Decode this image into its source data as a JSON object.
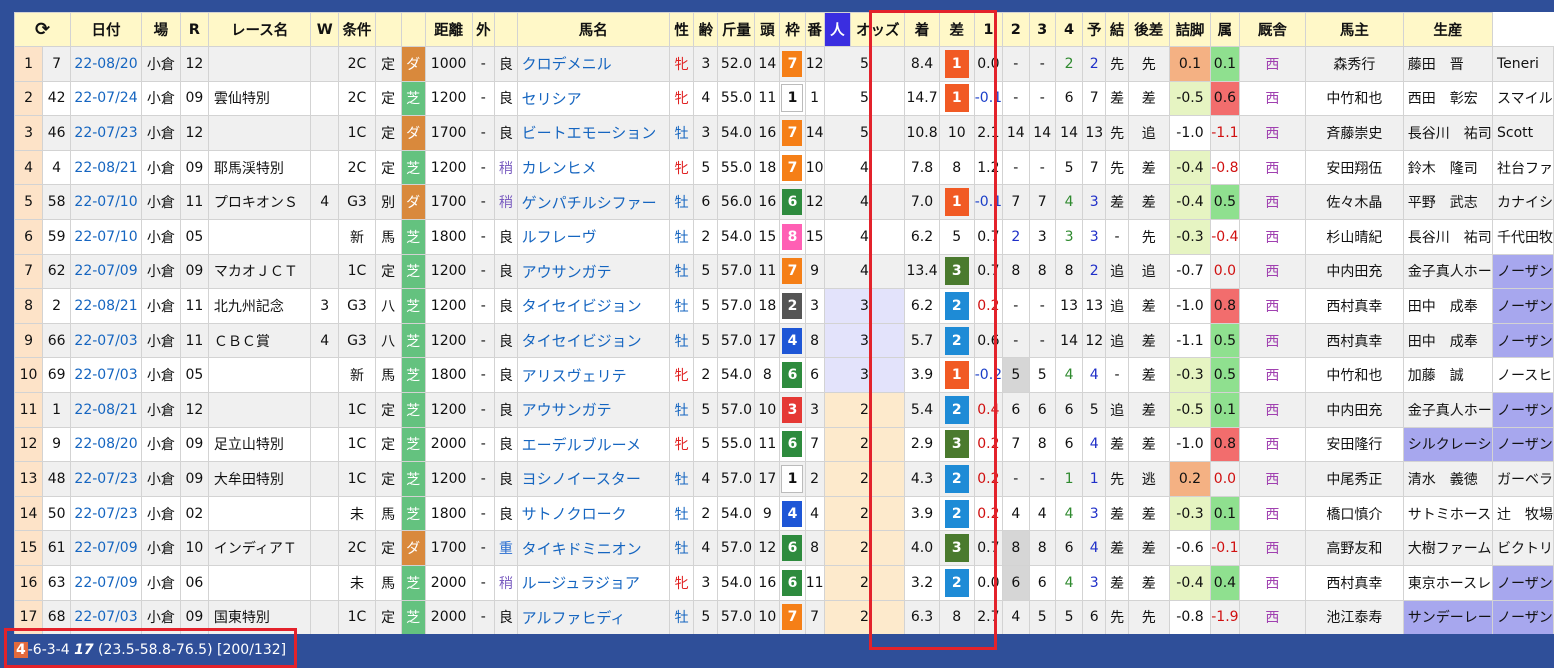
{
  "headers": [
    "⟳",
    "日付",
    "場",
    "R",
    "レース名",
    "W",
    "条件",
    "",
    "",
    "距離",
    "外",
    "",
    "馬名",
    "性",
    "齢",
    "斤量",
    "頭",
    "枠",
    "番",
    "人",
    "オッズ",
    "着",
    "差",
    "1",
    "2",
    "3",
    "4",
    "予",
    "結",
    "後差",
    "詰脚",
    "属",
    "厩舎",
    "馬主",
    "生産"
  ],
  "colors": {
    "waku": {
      "1": "#ffffff",
      "2": "#555555",
      "3": "#e53935",
      "4": "#1e56d6",
      "5": "#f4d03f",
      "6": "#2e8b3e",
      "7": "#f57f17",
      "8": "#ff5fb4"
    },
    "fin": {
      "1": "#f15a24",
      "2": "#1e8bd6",
      "3": "#4a7a2e",
      "x": "none"
    }
  },
  "rows": [
    {
      "i": "1",
      "n": "7",
      "date": "22-08/20",
      "place": "小倉",
      "r": "12",
      "race": "",
      "w": "",
      "cls": "2C",
      "cond": "定",
      "surf": "ダ",
      "dist": "1000",
      "out": "-",
      "going": "良",
      "horse": "クロデメニル",
      "sex": "牝",
      "age": "3",
      "kg": "52.0",
      "heads": "14",
      "waku": "7",
      "ban": "12",
      "pop": "5",
      "odds": "8.4",
      "fin": "1",
      "diff": "0.0",
      "p1": "-",
      "p2": "-",
      "p3": "2",
      "p4": "2",
      "yo": "先",
      "res": "先",
      "ato": "0.1",
      "tsu": "0.1",
      "reg": "西",
      "tr": "森秀行",
      "own": "藤田　晋",
      "brd": "Teneri"
    },
    {
      "i": "2",
      "n": "42",
      "date": "22-07/24",
      "place": "小倉",
      "r": "09",
      "race": "雲仙特別",
      "w": "",
      "cls": "2C",
      "cond": "定",
      "surf": "芝",
      "dist": "1200",
      "out": "-",
      "going": "良",
      "horse": "セリシア",
      "sex": "牝",
      "age": "4",
      "kg": "55.0",
      "heads": "11",
      "waku": "1",
      "ban": "1",
      "pop": "5",
      "odds": "14.7",
      "fin": "1",
      "diff": "-0.1",
      "p1": "-",
      "p2": "-",
      "p3": "6",
      "p4": "7",
      "yo": "差",
      "res": "差",
      "ato": "-0.5",
      "tsu": "0.6",
      "reg": "西",
      "tr": "中竹和也",
      "own": "西田　彰宏",
      "brd": "スマイル"
    },
    {
      "i": "3",
      "n": "46",
      "date": "22-07/23",
      "place": "小倉",
      "r": "12",
      "race": "",
      "w": "",
      "cls": "1C",
      "cond": "定",
      "surf": "ダ",
      "dist": "1700",
      "out": "-",
      "going": "良",
      "horse": "ビートエモーション",
      "sex": "牡",
      "age": "3",
      "kg": "54.0",
      "heads": "16",
      "waku": "7",
      "ban": "14",
      "pop": "5",
      "odds": "10.8",
      "fin": "10",
      "diff": "2.1",
      "p1": "14",
      "p2": "14",
      "p3": "14",
      "p4": "13",
      "yo": "先",
      "res": "追",
      "ato": "-1.0",
      "tsu": "-1.1",
      "reg": "西",
      "tr": "斉藤崇史",
      "own": "長谷川　祐司",
      "brd": "Scott"
    },
    {
      "i": "4",
      "n": "4",
      "date": "22-08/21",
      "place": "小倉",
      "r": "09",
      "race": "耶馬渓特別",
      "w": "",
      "cls": "2C",
      "cond": "定",
      "surf": "芝",
      "dist": "1200",
      "out": "-",
      "going": "稍",
      "horse": "カレンヒメ",
      "sex": "牝",
      "age": "5",
      "kg": "55.0",
      "heads": "18",
      "waku": "7",
      "ban": "10",
      "pop": "4",
      "odds": "7.8",
      "fin": "8",
      "diff": "1.2",
      "p1": "-",
      "p2": "-",
      "p3": "5",
      "p4": "7",
      "yo": "先",
      "res": "差",
      "ato": "-0.4",
      "tsu": "-0.8",
      "reg": "西",
      "tr": "安田翔伍",
      "own": "鈴木　隆司",
      "brd": "社台ファ"
    },
    {
      "i": "5",
      "n": "58",
      "date": "22-07/10",
      "place": "小倉",
      "r": "11",
      "race": "プロキオンＳ",
      "w": "4",
      "cls": "G3",
      "cond": "別",
      "surf": "ダ",
      "dist": "1700",
      "out": "-",
      "going": "稍",
      "horse": "ゲンパチルシファー",
      "sex": "牡",
      "age": "6",
      "kg": "56.0",
      "heads": "16",
      "waku": "6",
      "ban": "12",
      "pop": "4",
      "odds": "7.0",
      "fin": "1",
      "diff": "-0.1",
      "p1": "7",
      "p2": "7",
      "p3": "4",
      "p4": "3",
      "yo": "差",
      "res": "差",
      "ato": "-0.4",
      "tsu": "0.5",
      "reg": "西",
      "tr": "佐々木晶",
      "own": "平野　武志",
      "brd": "カナイシ"
    },
    {
      "i": "6",
      "n": "59",
      "date": "22-07/10",
      "place": "小倉",
      "r": "05",
      "race": "",
      "w": "",
      "cls": "新",
      "cond": "馬",
      "surf": "芝",
      "dist": "1800",
      "out": "-",
      "going": "良",
      "horse": "ルフレーヴ",
      "sex": "牡",
      "age": "2",
      "kg": "54.0",
      "heads": "15",
      "waku": "8",
      "ban": "15",
      "pop": "4",
      "odds": "6.2",
      "fin": "5",
      "diff": "0.7",
      "p1": "2",
      "p2": "3",
      "p3": "3",
      "p4": "3",
      "yo": "-",
      "res": "先",
      "ato": "-0.3",
      "tsu": "-0.4",
      "reg": "西",
      "tr": "杉山晴紀",
      "own": "長谷川　祐司",
      "brd": "千代田牧"
    },
    {
      "i": "7",
      "n": "62",
      "date": "22-07/09",
      "place": "小倉",
      "r": "09",
      "race": "マカオＪＣＴ",
      "w": "",
      "cls": "1C",
      "cond": "定",
      "surf": "芝",
      "dist": "1200",
      "out": "-",
      "going": "良",
      "horse": "アウサンガテ",
      "sex": "牡",
      "age": "5",
      "kg": "57.0",
      "heads": "11",
      "waku": "7",
      "ban": "9",
      "pop": "4",
      "odds": "13.4",
      "fin": "3",
      "diff": "0.7",
      "p1": "8",
      "p2": "8",
      "p3": "8",
      "p4": "2",
      "yo": "追",
      "res": "追",
      "ato": "-0.7",
      "tsu": "0.0",
      "reg": "西",
      "tr": "中内田充",
      "own": "金子真人ホー",
      "brd": "ノーザン"
    },
    {
      "i": "8",
      "n": "2",
      "date": "22-08/21",
      "place": "小倉",
      "r": "11",
      "race": "北九州記念",
      "w": "3",
      "cls": "G3",
      "cond": "八",
      "surf": "芝",
      "dist": "1200",
      "out": "-",
      "going": "良",
      "horse": "タイセイビジョン",
      "sex": "牡",
      "age": "5",
      "kg": "57.0",
      "heads": "18",
      "waku": "2",
      "ban": "3",
      "pop": "3",
      "odds": "6.2",
      "fin": "2",
      "diff": "0.2",
      "p1": "-",
      "p2": "-",
      "p3": "13",
      "p4": "13",
      "yo": "追",
      "res": "差",
      "ato": "-1.0",
      "tsu": "0.8",
      "reg": "西",
      "tr": "西村真幸",
      "own": "田中　成奉",
      "brd": "ノーザン"
    },
    {
      "i": "9",
      "n": "66",
      "date": "22-07/03",
      "place": "小倉",
      "r": "11",
      "race": "ＣＢＣ賞",
      "w": "4",
      "cls": "G3",
      "cond": "八",
      "surf": "芝",
      "dist": "1200",
      "out": "-",
      "going": "良",
      "horse": "タイセイビジョン",
      "sex": "牡",
      "age": "5",
      "kg": "57.0",
      "heads": "17",
      "waku": "4",
      "ban": "8",
      "pop": "3",
      "odds": "5.7",
      "fin": "2",
      "diff": "0.6",
      "p1": "-",
      "p2": "-",
      "p3": "14",
      "p4": "12",
      "yo": "追",
      "res": "差",
      "ato": "-1.1",
      "tsu": "0.5",
      "reg": "西",
      "tr": "西村真幸",
      "own": "田中　成奉",
      "brd": "ノーザン"
    },
    {
      "i": "10",
      "n": "69",
      "date": "22-07/03",
      "place": "小倉",
      "r": "05",
      "race": "",
      "w": "",
      "cls": "新",
      "cond": "馬",
      "surf": "芝",
      "dist": "1800",
      "out": "-",
      "going": "良",
      "horse": "アリスヴェリテ",
      "sex": "牝",
      "age": "2",
      "kg": "54.0",
      "heads": "8",
      "waku": "6",
      "ban": "6",
      "pop": "3",
      "odds": "3.9",
      "fin": "1",
      "diff": "-0.2",
      "p1": "5",
      "p2": "5",
      "p3": "4",
      "p4": "4",
      "yo": "-",
      "res": "差",
      "ato": "-0.3",
      "tsu": "0.5",
      "reg": "西",
      "tr": "中竹和也",
      "own": "加藤　誠",
      "brd": "ノースヒ"
    },
    {
      "i": "11",
      "n": "1",
      "date": "22-08/21",
      "place": "小倉",
      "r": "12",
      "race": "",
      "w": "",
      "cls": "1C",
      "cond": "定",
      "surf": "芝",
      "dist": "1200",
      "out": "-",
      "going": "良",
      "horse": "アウサンガテ",
      "sex": "牡",
      "age": "5",
      "kg": "57.0",
      "heads": "10",
      "waku": "3",
      "ban": "3",
      "pop": "2",
      "odds": "5.4",
      "fin": "2",
      "diff": "0.4",
      "p1": "6",
      "p2": "6",
      "p3": "6",
      "p4": "5",
      "yo": "追",
      "res": "差",
      "ato": "-0.5",
      "tsu": "0.1",
      "reg": "西",
      "tr": "中内田充",
      "own": "金子真人ホー",
      "brd": "ノーザン"
    },
    {
      "i": "12",
      "n": "9",
      "date": "22-08/20",
      "place": "小倉",
      "r": "09",
      "race": "足立山特別",
      "w": "",
      "cls": "1C",
      "cond": "定",
      "surf": "芝",
      "dist": "2000",
      "out": "-",
      "going": "良",
      "horse": "エーデルブルーメ",
      "sex": "牝",
      "age": "5",
      "kg": "55.0",
      "heads": "11",
      "waku": "6",
      "ban": "7",
      "pop": "2",
      "odds": "2.9",
      "fin": "3",
      "diff": "0.2",
      "p1": "7",
      "p2": "8",
      "p3": "6",
      "p4": "4",
      "yo": "差",
      "res": "差",
      "ato": "-1.0",
      "tsu": "0.8",
      "reg": "西",
      "tr": "安田隆行",
      "own": "シルクレーシ",
      "brd": "ノーザン"
    },
    {
      "i": "13",
      "n": "48",
      "date": "22-07/23",
      "place": "小倉",
      "r": "09",
      "race": "大牟田特別",
      "w": "",
      "cls": "1C",
      "cond": "定",
      "surf": "芝",
      "dist": "1200",
      "out": "-",
      "going": "良",
      "horse": "ヨシノイースター",
      "sex": "牡",
      "age": "4",
      "kg": "57.0",
      "heads": "17",
      "waku": "1",
      "ban": "2",
      "pop": "2",
      "odds": "4.3",
      "fin": "2",
      "diff": "0.2",
      "p1": "-",
      "p2": "-",
      "p3": "1",
      "p4": "1",
      "yo": "先",
      "res": "逃",
      "ato": "0.2",
      "tsu": "0.0",
      "reg": "西",
      "tr": "中尾秀正",
      "own": "清水　義徳",
      "brd": "ガーベラ"
    },
    {
      "i": "14",
      "n": "50",
      "date": "22-07/23",
      "place": "小倉",
      "r": "02",
      "race": "",
      "w": "",
      "cls": "未",
      "cond": "馬",
      "surf": "芝",
      "dist": "1800",
      "out": "-",
      "going": "良",
      "horse": "サトノクローク",
      "sex": "牡",
      "age": "2",
      "kg": "54.0",
      "heads": "9",
      "waku": "4",
      "ban": "4",
      "pop": "2",
      "odds": "3.9",
      "fin": "2",
      "diff": "0.2",
      "p1": "4",
      "p2": "4",
      "p3": "4",
      "p4": "3",
      "yo": "差",
      "res": "差",
      "ato": "-0.3",
      "tsu": "0.1",
      "reg": "西",
      "tr": "橋口慎介",
      "own": "サトミホース",
      "brd": "辻　牧場"
    },
    {
      "i": "15",
      "n": "61",
      "date": "22-07/09",
      "place": "小倉",
      "r": "10",
      "race": "インディアＴ",
      "w": "",
      "cls": "2C",
      "cond": "定",
      "surf": "ダ",
      "dist": "1700",
      "out": "-",
      "going": "重",
      "horse": "タイキドミニオン",
      "sex": "牡",
      "age": "4",
      "kg": "57.0",
      "heads": "12",
      "waku": "6",
      "ban": "8",
      "pop": "2",
      "odds": "4.0",
      "fin": "3",
      "diff": "0.7",
      "p1": "8",
      "p2": "8",
      "p3": "6",
      "p4": "4",
      "yo": "差",
      "res": "差",
      "ato": "-0.6",
      "tsu": "-0.1",
      "reg": "西",
      "tr": "高野友和",
      "own": "大樹ファーム",
      "brd": "ビクトリ"
    },
    {
      "i": "16",
      "n": "63",
      "date": "22-07/09",
      "place": "小倉",
      "r": "06",
      "race": "",
      "w": "",
      "cls": "未",
      "cond": "馬",
      "surf": "芝",
      "dist": "2000",
      "out": "-",
      "going": "稍",
      "horse": "ルージュラジョア",
      "sex": "牝",
      "age": "3",
      "kg": "54.0",
      "heads": "16",
      "waku": "6",
      "ban": "11",
      "pop": "2",
      "odds": "3.2",
      "fin": "2",
      "diff": "0.0",
      "p1": "6",
      "p2": "6",
      "p3": "4",
      "p4": "3",
      "yo": "差",
      "res": "差",
      "ato": "-0.4",
      "tsu": "0.4",
      "reg": "西",
      "tr": "西村真幸",
      "own": "東京ホースレ",
      "brd": "ノーザン"
    },
    {
      "i": "17",
      "n": "68",
      "date": "22-07/03",
      "place": "小倉",
      "r": "09",
      "race": "国東特別",
      "w": "",
      "cls": "1C",
      "cond": "定",
      "surf": "芝",
      "dist": "2000",
      "out": "-",
      "going": "良",
      "horse": "アルファヒディ",
      "sex": "牡",
      "age": "5",
      "kg": "57.0",
      "heads": "10",
      "waku": "7",
      "ban": "7",
      "pop": "2",
      "odds": "6.3",
      "fin": "8",
      "diff": "2.7",
      "p1": "4",
      "p2": "5",
      "p3": "5",
      "p4": "6",
      "yo": "先",
      "res": "先",
      "ato": "-0.8",
      "tsu": "-1.9",
      "reg": "西",
      "tr": "池江泰寿",
      "own": "サンデーレー",
      "brd": "ノーザン"
    }
  ],
  "status": {
    "first": "4",
    "rest": "-6-3-4 ",
    "count": "17",
    "tail": " (23.5-58.8-76.5) [200/132]"
  }
}
